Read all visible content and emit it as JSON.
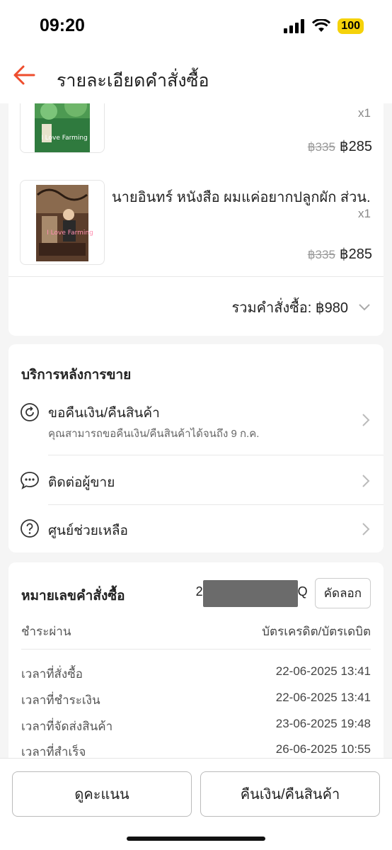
{
  "status_bar": {
    "time": "09:20",
    "battery": "100"
  },
  "header": {
    "title": "รายละเอียดคำสั่งซื้อ",
    "accent_color": "#ee4d2d"
  },
  "products": [
    {
      "name": "",
      "qty": "x1",
      "price_original": "฿335",
      "price": "฿285",
      "cover_text": "I Love Farming"
    },
    {
      "name": "นายอินทร์ หนังสือ ผมแค่อยากปลูกผัก ส่วน...",
      "qty": "x1",
      "price_original": "฿335",
      "price": "฿285",
      "cover_text": "I Love Farming"
    }
  ],
  "order_total": {
    "label": "รวมคำสั่งซื้อ: ฿980"
  },
  "after_sales": {
    "title": "บริการหลังการขาย",
    "items": [
      {
        "label": "ขอคืนเงิน/คืนสินค้า",
        "sub": "คุณสามารถขอคืนเงิน/คืนสินค้าได้จนถึง 9 ก.ค.",
        "icon": "refresh-icon"
      },
      {
        "label": "ติดต่อผู้ขาย",
        "icon": "chat-icon"
      },
      {
        "label": "ศูนย์ช่วยเหลือ",
        "icon": "help-icon"
      }
    ]
  },
  "order_info": {
    "title": "หมายเลขคำสั่งซื้อ",
    "order_number_lead": "2",
    "order_number_tail": "Q",
    "copy_label": "คัดลอก",
    "rows": [
      {
        "label": "ชำระผ่าน",
        "value": "บัตรเครดิต/บัตรเดบิต"
      },
      {
        "label": "เวลาที่สั่งซื้อ",
        "value": "22-06-2025 13:41"
      },
      {
        "label": "เวลาที่ชำระเงิน",
        "value": "22-06-2025 13:41"
      },
      {
        "label": "เวลาที่จัดส่งสินค้า",
        "value": "23-06-2025 19:48"
      },
      {
        "label": "เวลาที่สำเร็จ",
        "value": "26-06-2025 10:55"
      }
    ]
  },
  "bottom": {
    "rate_label": "ดูคะแนน",
    "refund_label": "คืนเงิน/คืนสินค้า"
  }
}
